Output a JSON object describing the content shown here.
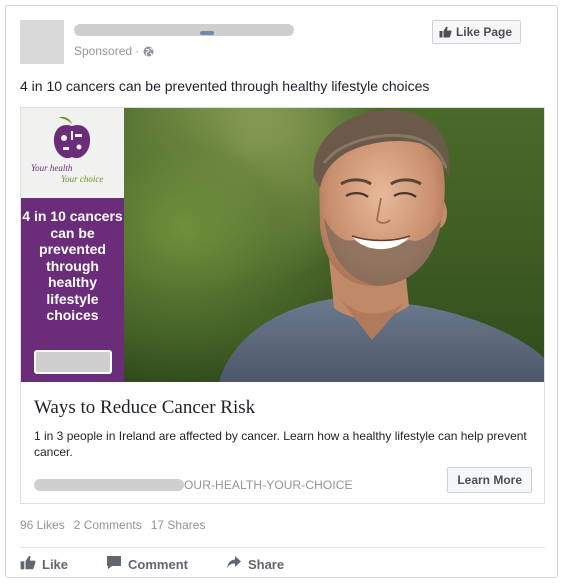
{
  "header": {
    "sponsored_label": "Sponsored ·",
    "like_page_label": "Like Page"
  },
  "post": {
    "text": "4 in 10 cancers can be prevented through healthy lifestyle choices"
  },
  "ad": {
    "brand": {
      "tagline_1": "Your health",
      "tagline_2": "Your choice",
      "headline": "4 in 10 cancers can be prevented through healthy lifestyle choices"
    },
    "headline": "Ways to Reduce Cancer Risk",
    "description": "1 in 3 people in Ireland are affected by cancer. Learn how a healthy lifestyle can help prevent cancer.",
    "url_suffix": "OUR-HEALTH-YOUR-CHOICE",
    "cta_label": "Learn More"
  },
  "stats": {
    "likes": "96 Likes",
    "comments": "2 Comments",
    "shares": "17 Shares"
  },
  "actions": {
    "like": "Like",
    "comment": "Comment",
    "share": "Share"
  },
  "colors": {
    "brand_purple": "#6b2c7a",
    "brand_green": "#5c9a2d",
    "button_bg": "#f6f7f9",
    "muted_text": "#90949c"
  },
  "icons": {
    "globe": "globe-icon",
    "thumbs_up": "thumbs-up-icon",
    "comment": "comment-icon",
    "share": "share-arrow-icon",
    "brand_logo": "apple-logo-icon"
  }
}
